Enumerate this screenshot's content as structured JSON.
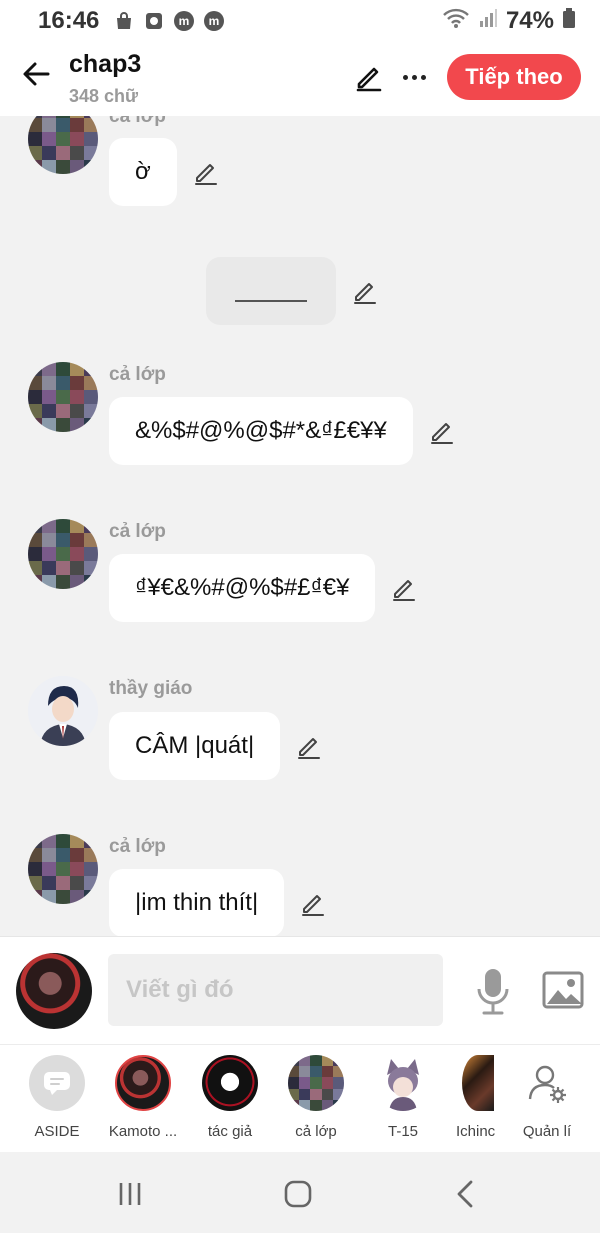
{
  "status": {
    "time": "16:46",
    "battery": "74%"
  },
  "header": {
    "title": "chap3",
    "subtitle": "348 chữ",
    "next_label": "Tiếp theo"
  },
  "messages": [
    {
      "sender": "cả lớp",
      "text": "ờ"
    },
    {
      "sender": "",
      "text": ""
    },
    {
      "sender": "cả lớp",
      "text": "&%$#@%@$#*&₫£€¥¥"
    },
    {
      "sender": "cả lớp",
      "text": "₫¥€&%#@%$#£₫€¥"
    },
    {
      "sender": "thầy giáo",
      "text": "CÂM |quát|"
    },
    {
      "sender": "cả lớp",
      "text": "|im thin thít|"
    }
  ],
  "composer": {
    "placeholder": "Viết gì đó"
  },
  "characters": [
    {
      "label": "ASIDE"
    },
    {
      "label": "Kamoto ..."
    },
    {
      "label": "tác giả"
    },
    {
      "label": "cả lớp"
    },
    {
      "label": "T-15"
    },
    {
      "label": "Ichinc"
    },
    {
      "label": "Quản lí"
    }
  ],
  "colors": {
    "accent": "#f2484d",
    "background": "#f2f2f2",
    "bubble": "#ffffff"
  }
}
